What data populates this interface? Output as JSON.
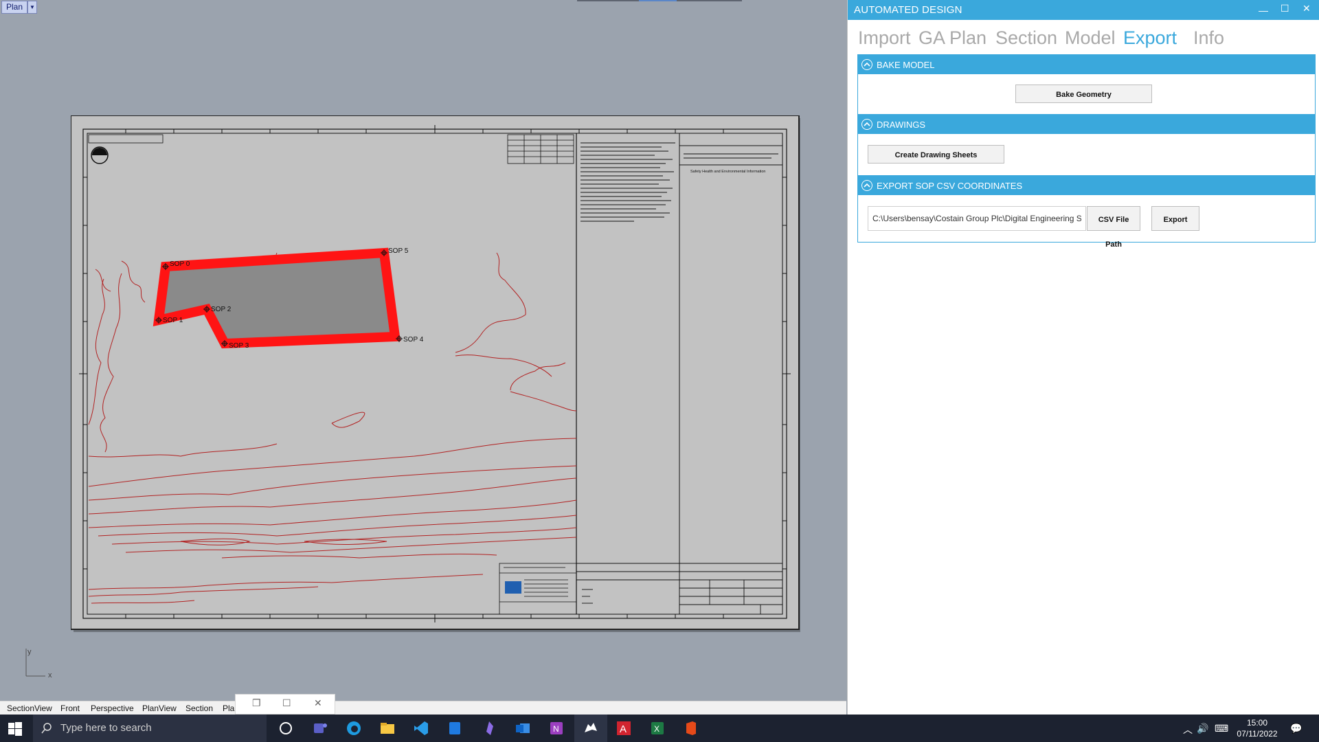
{
  "viewport": {
    "active_tab": "Plan",
    "sop_labels": [
      "SOP 0",
      "SOP 1",
      "SOP 2",
      "SOP 3",
      "SOP 4",
      "SOP 5"
    ],
    "title_block_text": "Safety Health and Environmental Information",
    "axis_y": "y",
    "axis_x": "x"
  },
  "viewport_tabs": [
    "SectionView",
    "Front",
    "Perspective",
    "PlanView",
    "Section",
    "Pla"
  ],
  "panel": {
    "title": "AUTOMATED DESIGN",
    "tabs": [
      "Import",
      "GA Plan",
      "Section",
      "Model",
      "Export",
      "Info"
    ],
    "active_tab": "Export",
    "sections": {
      "bake": {
        "title": "BAKE MODEL",
        "button": "Bake Geometry"
      },
      "drawings": {
        "title": "DRAWINGS",
        "button": "Create Drawing Sheets"
      },
      "export": {
        "title": "EXPORT SOP CSV COORDINATES",
        "path_value": "C:\\Users\\bensay\\Costain Group Plc\\Digital Engineering Solu",
        "path_button": "CSV File Path",
        "export_button": "Export"
      }
    }
  },
  "taskbar": {
    "search_placeholder": "Type here to search",
    "time": "15:00",
    "date": "07/11/2022"
  },
  "colors": {
    "accent": "#3aa8dc",
    "boundary": "#ff0000",
    "contour": "#b22222",
    "viewport_bg": "#9ba3ae",
    "sheet_bg": "#c2c2c2"
  }
}
